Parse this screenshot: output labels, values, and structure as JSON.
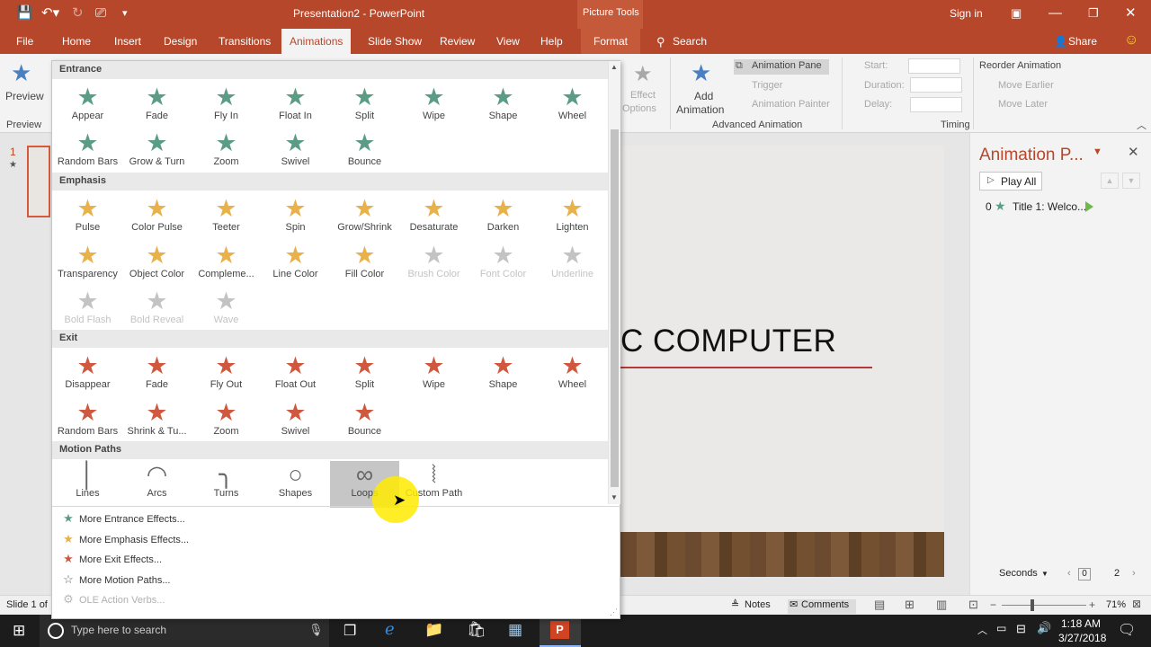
{
  "window": {
    "title": "Presentation2 - PowerPoint",
    "context_tab": "Picture Tools",
    "sign_in": "Sign in"
  },
  "tabs": [
    "File",
    "Home",
    "Insert",
    "Design",
    "Transitions",
    "Animations",
    "Slide Show",
    "Review",
    "View",
    "Help",
    "Format"
  ],
  "active_tab": "Animations",
  "search": {
    "label": "Search"
  },
  "share": "Share",
  "ribbon": {
    "preview_label": "Preview",
    "preview_group": "Preview",
    "effect_options": [
      "Effect",
      "Options"
    ],
    "add_animation": [
      "Add",
      "Animation"
    ],
    "animation_pane": "Animation Pane",
    "trigger": "Trigger",
    "animation_painter": "Animation Painter",
    "advanced_group": "Advanced Animation",
    "start": "Start:",
    "duration": "Duration:",
    "delay": "Delay:",
    "timing_group": "Timing",
    "reorder": "Reorder Animation",
    "move_earlier": "Move Earlier",
    "move_later": "Move Later"
  },
  "thumbnail": {
    "number": "1"
  },
  "slide": {
    "title_fragment": "C COMPUTER"
  },
  "animation_pane": {
    "title": "Animation P...",
    "play_all": "Play All",
    "item_index": "0",
    "item_label": "Title 1: Welco...",
    "seconds": "Seconds",
    "page_start": "0",
    "page_end": "2"
  },
  "gallery": {
    "sections": {
      "entrance": "Entrance",
      "emphasis": "Emphasis",
      "exit": "Exit",
      "motion": "Motion Paths"
    },
    "entrance": [
      "Appear",
      "Fade",
      "Fly In",
      "Float In",
      "Split",
      "Wipe",
      "Shape",
      "Wheel",
      "Random Bars",
      "Grow & Turn",
      "Zoom",
      "Swivel",
      "Bounce"
    ],
    "emphasis": [
      "Pulse",
      "Color Pulse",
      "Teeter",
      "Spin",
      "Grow/Shrink",
      "Desaturate",
      "Darken",
      "Lighten",
      "Transparency",
      "Object Color",
      "Compleme...",
      "Line Color",
      "Fill Color",
      "Brush Color",
      "Font Color",
      "Underline",
      "Bold Flash",
      "Bold Reveal",
      "Wave"
    ],
    "exit": [
      "Disappear",
      "Fade",
      "Fly Out",
      "Float Out",
      "Split",
      "Wipe",
      "Shape",
      "Wheel",
      "Random Bars",
      "Shrink & Tu...",
      "Zoom",
      "Swivel",
      "Bounce"
    ],
    "motion": [
      "Lines",
      "Arcs",
      "Turns",
      "Shapes",
      "Loops",
      "Custom Path"
    ],
    "more": [
      "More Entrance Effects...",
      "More Emphasis Effects...",
      "More Exit Effects...",
      "More Motion Paths...",
      "OLE Action Verbs..."
    ]
  },
  "status": {
    "slide": "Slide 1 of",
    "notes": "Notes",
    "comments": "Comments",
    "zoom": "71%"
  },
  "taskbar": {
    "search_placeholder": "Type here to search",
    "time": "1:18 AM",
    "date": "3/27/2018"
  }
}
